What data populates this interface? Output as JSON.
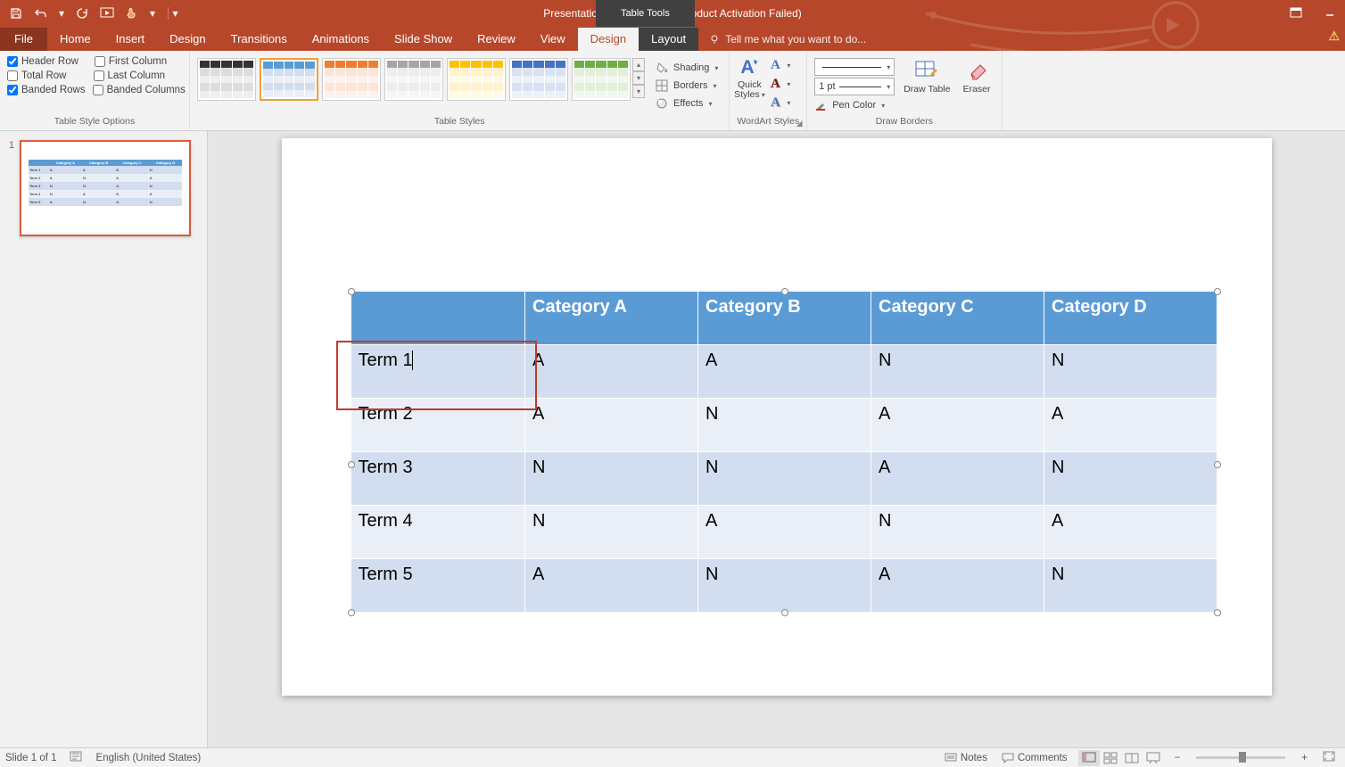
{
  "titlebar": {
    "title": "Presentation1 - PowerPoint (Product Activation Failed)",
    "tools_context": "Table Tools"
  },
  "ribbon_tabs": {
    "file": "File",
    "home": "Home",
    "insert": "Insert",
    "design": "Design",
    "transitions": "Transitions",
    "animations": "Animations",
    "slideshow": "Slide Show",
    "review": "Review",
    "view": "View",
    "ctx_design": "Design",
    "ctx_layout": "Layout",
    "tellme": "Tell me what you want to do..."
  },
  "ribbon": {
    "style_options": {
      "header_row": "Header Row",
      "total_row": "Total Row",
      "banded_rows": "Banded Rows",
      "first_column": "First Column",
      "last_column": "Last Column",
      "banded_columns": "Banded Columns",
      "group_label": "Table Style Options"
    },
    "table_styles_label": "Table Styles",
    "shading": "Shading",
    "borders": "Borders",
    "effects": "Effects",
    "quick_styles": "Quick Styles",
    "wordart_label": "WordArt Styles",
    "pen_style_value": "",
    "pen_weight_value": "1 pt",
    "pen_color": "Pen Color",
    "draw_table": "Draw Table",
    "eraser": "Eraser",
    "draw_borders_label": "Draw Borders"
  },
  "thumbnail": {
    "number": "1"
  },
  "table": {
    "headers": [
      "",
      "Category A",
      "Category B",
      "Category C",
      "Category D"
    ],
    "rows": [
      {
        "label": "Term 1",
        "cells": [
          "A",
          "A",
          "N",
          "N"
        ]
      },
      {
        "label": "Term 2",
        "cells": [
          "A",
          "N",
          "A",
          "A"
        ]
      },
      {
        "label": "Term 3",
        "cells": [
          "N",
          "N",
          "A",
          "N"
        ]
      },
      {
        "label": "Term 4",
        "cells": [
          "N",
          "A",
          "N",
          "A"
        ]
      },
      {
        "label": "Term 5",
        "cells": [
          "A",
          "N",
          "A",
          "N"
        ]
      }
    ]
  },
  "statusbar": {
    "slide": "Slide 1 of 1",
    "language": "English (United States)",
    "notes": "Notes",
    "comments": "Comments"
  }
}
